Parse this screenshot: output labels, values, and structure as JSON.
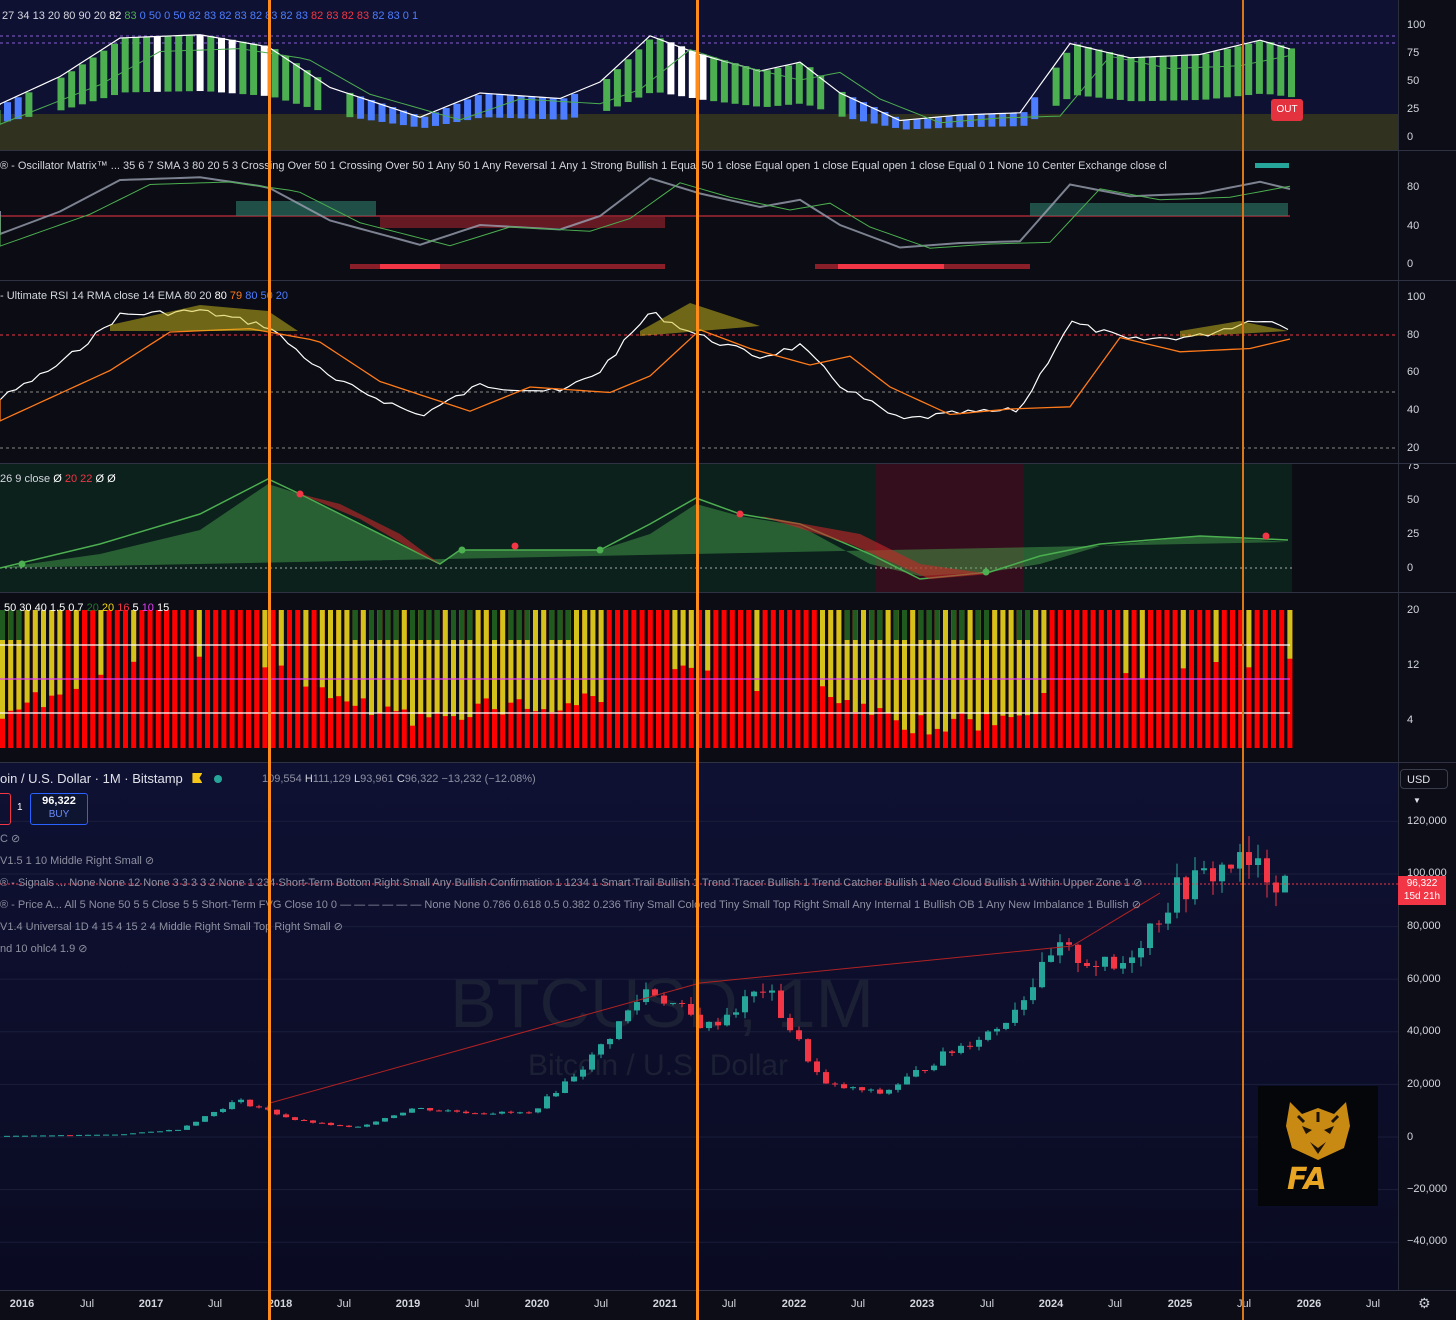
{
  "panes": {
    "p1": {
      "legend": [
        "27",
        "34",
        "13",
        "20",
        "80",
        "90",
        "20",
        "82",
        "83",
        "0",
        "50",
        "0",
        "50",
        "82",
        "83",
        "82",
        "83",
        "82",
        "83",
        "82",
        "83",
        "82",
        "83",
        "82",
        "83",
        "82",
        "83",
        "0",
        "1"
      ],
      "legend_colors": [
        "#d4d6de",
        "#d4d6de",
        "#d4d6de",
        "#d4d6de",
        "#d4d6de",
        "#d4d6de",
        "#d4d6de",
        "#ffffff",
        "#4caf50",
        "#4c7dff",
        "#4c7dff",
        "#4c7dff",
        "#4c7dff",
        "#4c7dff",
        "#4c7dff",
        "#4c7dff",
        "#4c7dff",
        "#4c7dff",
        "#4c7dff",
        "#4c7dff",
        "#4c7dff",
        "#f23645",
        "#f23645",
        "#f23645",
        "#f23645",
        "#4c7dff",
        "#4c7dff",
        "#4c7dff",
        "#4c7dff",
        "#f23645"
      ],
      "ticks": [
        "100",
        "75",
        "50",
        "25",
        "0"
      ],
      "out_label": "OUT"
    },
    "p2": {
      "legend": "® - Oscillator Matrix™ ... 35 6 7 SMA 3 80 20 5 3 Crossing Over 50 1 Crossing Over 50 1 Any 50 1 Any Reversal 1 Any 1 Strong Bullish 1 Equal 50 1 close Equal open 1 close Equal open 1 close Equal 0 1 None 10 Center Exchange close cl",
      "ticks": [
        "80",
        "40",
        "0"
      ]
    },
    "p3": {
      "legend_main": "- Ultimate RSI 14 RMA close 14 EMA 80 20",
      "legend_vals": [
        "80",
        "79",
        "80",
        "50",
        "20"
      ],
      "legend_colors": [
        "#ffffff",
        "#ff7a1a",
        "#4c7dff",
        "#4c7dff",
        "#4c7dff"
      ],
      "ticks": [
        "100",
        "80",
        "60",
        "40",
        "20"
      ]
    },
    "p4": {
      "legend_main": "26 9 close",
      "legend_vals": [
        "Ø",
        "20",
        "22",
        "Ø",
        "Ø"
      ],
      "legend_colors": [
        "#ffffff",
        "#f23645",
        "#f23645",
        "#ffffff",
        "#ffffff"
      ],
      "ticks": [
        "75",
        "50",
        "25",
        "0"
      ]
    },
    "p5": {
      "legend_vals": [
        "50",
        "30",
        "40",
        "1.5",
        "0.7",
        "20",
        "20",
        "16",
        "5",
        "10",
        "15"
      ],
      "legend_colors": [
        "#ffffff",
        "#ffffff",
        "#ffffff",
        "#ffffff",
        "#ffffff",
        "#1f7a2e",
        "#f5d90a",
        "#f23645",
        "#ffffff",
        "#e040fb",
        "#ffffff"
      ],
      "ticks": [
        "20",
        "12",
        "4"
      ]
    }
  },
  "main": {
    "symbol_title": "oin / U.S. Dollar · 1M · Bitstamp",
    "ohlc": {
      "o_label": "O",
      "o": "109,554",
      "h_label": "H",
      "h": "111,129",
      "l_label": "L",
      "l": "93,961",
      "c_label": "C",
      "c": "96,322",
      "chg": "−13,232 (−12.08%)"
    },
    "buy_price": "96,322",
    "buy_label": "BUY",
    "qty": "1",
    "currency": "USD",
    "last_price": "96,322",
    "countdown": "15d 21h",
    "indicators": [
      "C",
      "V1.5 1 10 Middle Right Small",
      "® - Signals ...  None None 12 None 3 3 3 3 2 None 1 234 Short-Term Bottom Right Small Any Bullish Confirmation 1 1234 1 Smart Trail Bullish 1 Trend Tracer Bullish 1 Trend Catcher Bullish 1 Neo Cloud Bullish 1 Within Upper Zone 1",
      "® - Price A...  All 5 None 50 5 5 Close 5 5 Short-Term FVG Close 10 0 — — — — — — None None 0.786 0.618 0.5 0.382 0.236 Tiny Small Colored Tiny Small Top Right Small Any Internal 1 Bullish OB 1 Any New Imbalance 1 Bullish",
      "V1.4 Universal 1D 4 15 4 15 2 4 Middle Right Small Top Right Small",
      "nd 10 ohlc4 1.9"
    ],
    "price_ticks": [
      "120,000",
      "100,000",
      "80,000",
      "60,000",
      "40,000",
      "20,000",
      "0",
      "−20,000",
      "−40,000"
    ],
    "watermark_symbol": "BTCUSD, 1M",
    "watermark_name": "Bitcoin / U.S. Dollar",
    "logo_text": "FA"
  },
  "time_axis": [
    "2016",
    "Jul",
    "2017",
    "Jul",
    "2018",
    "Jul",
    "2019",
    "Jul",
    "2020",
    "Jul",
    "2021",
    "Jul",
    "2022",
    "Jul",
    "2023",
    "Jul",
    "2024",
    "Jul",
    "2025",
    "Jul",
    "2026",
    "Jul"
  ],
  "colors": {
    "bull": "#26a69a",
    "bear": "#f23645",
    "orange_line": "#ff8c1a",
    "pane_bg": "#0d0f2e",
    "green": "#4caf50",
    "blue": "#4c7dff",
    "yellow": "#d4c21a",
    "red": "#ff0000"
  },
  "chart_data": {
    "type": "candlestick",
    "interval": "1M",
    "x": [
      "2016-01",
      "2016-07",
      "2017-01",
      "2017-07",
      "2017-12",
      "2018-06",
      "2019-01",
      "2019-06",
      "2020-01",
      "2020-06",
      "2020-12",
      "2021-04",
      "2021-07",
      "2021-11",
      "2022-06",
      "2022-12",
      "2023-06",
      "2023-12",
      "2024-03",
      "2024-09",
      "2024-12",
      "2025-05",
      "2025-10"
    ],
    "close": [
      430,
      670,
      960,
      2900,
      14000,
      6400,
      3400,
      11000,
      9300,
      9100,
      29000,
      57000,
      41500,
      57000,
      19900,
      16500,
      30500,
      42300,
      71000,
      63300,
      93400,
      104600,
      96322
    ],
    "ylim": [
      -40000,
      130000
    ]
  }
}
